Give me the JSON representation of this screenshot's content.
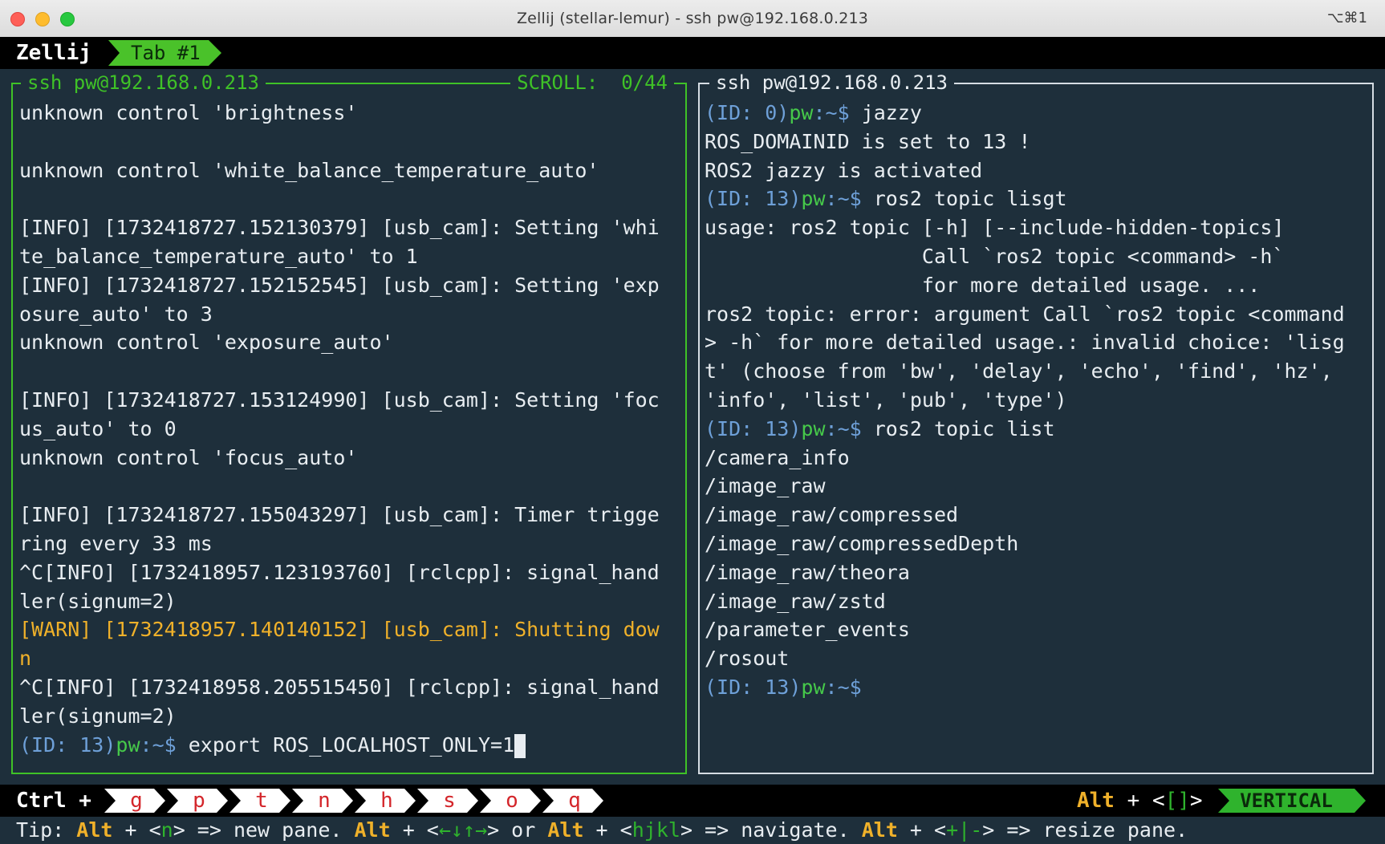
{
  "window": {
    "title": "Zellij (stellar-lemur) - ssh pw@192.168.0.213",
    "shortcut": "⌥⌘1"
  },
  "tabbar": {
    "brand": "Zellij",
    "tab": "Tab #1"
  },
  "left_pane": {
    "title": "ssh pw@192.168.0.213",
    "scroll": "SCROLL:  0/44",
    "lines": [
      "unknown control 'brightness'",
      "",
      "unknown control 'white_balance_temperature_auto'",
      "",
      "[INFO] [1732418727.152130379] [usb_cam]: Setting 'whi",
      "te_balance_temperature_auto' to 1",
      "[INFO] [1732418727.152152545] [usb_cam]: Setting 'exp",
      "osure_auto' to 3",
      "unknown control 'exposure_auto'",
      "",
      "[INFO] [1732418727.153124990] [usb_cam]: Setting 'foc",
      "us_auto' to 0",
      "unknown control 'focus_auto'",
      "",
      "[INFO] [1732418727.155043297] [usb_cam]: Timer trigge",
      "ring every 33 ms",
      "^C[INFO] [1732418957.123193760] [rclcpp]: signal_hand",
      "ler(signum=2)",
      "[WARN] [1732418957.140140152] [usb_cam]: Shutting dow",
      "n",
      "^C[INFO] [1732418958.205515450] [rclcpp]: signal_hand",
      "ler(signum=2)"
    ],
    "prompt": {
      "id": "(ID: 13)",
      "user": "pw",
      "path": ":~$ ",
      "command": "export ROS_LOCALHOST_ONLY=1"
    }
  },
  "right_pane": {
    "title": "ssh pw@192.168.0.213",
    "prompt1": {
      "id": "(ID: 0)",
      "user": "pw",
      "path": ":~$ ",
      "command": "jazzy"
    },
    "block1": [
      "ROS_DOMAINID is set to 13 !",
      "ROS2 jazzy is activated"
    ],
    "prompt2": {
      "id": "(ID: 13)",
      "user": "pw",
      "path": ":~$ ",
      "command": "ros2 topic lisgt"
    },
    "block2": [
      "usage: ros2 topic [-h] [--include-hidden-topics]",
      "                  Call `ros2 topic <command> -h`",
      "                  for more detailed usage. ...",
      "ros2 topic: error: argument Call `ros2 topic <command",
      "> -h` for more detailed usage.: invalid choice: 'lisg",
      "t' (choose from 'bw', 'delay', 'echo', 'find', 'hz',",
      "'info', 'list', 'pub', 'type')"
    ],
    "prompt3": {
      "id": "(ID: 13)",
      "user": "pw",
      "path": ":~$ ",
      "command": "ros2 topic list"
    },
    "block3": [
      "/camera_info",
      "/image_raw",
      "/image_raw/compressed",
      "/image_raw/compressedDepth",
      "/image_raw/theora",
      "/image_raw/zstd",
      "/parameter_events",
      "/rosout"
    ],
    "prompt4": {
      "id": "(ID: 13)",
      "user": "pw",
      "path": ":~$",
      "command": ""
    }
  },
  "statusbar": {
    "ctrl": "Ctrl +",
    "keys": [
      "g",
      "p",
      "t",
      "n",
      "h",
      "s",
      "o",
      "q"
    ],
    "alt": "Alt",
    "plus": " + ",
    "bracket_open": "<",
    "bracket_keys": "[]",
    "bracket_close": ">",
    "mode": "VERTICAL"
  },
  "tip": {
    "prefix": "Tip: ",
    "alt": "Alt",
    "k1": "n",
    "t1": "> => new pane. ",
    "k2": "←↓↑→",
    "t2": "> or ",
    "k3": "hjkl",
    "t3": "> => navigate. ",
    "k4": "+|-",
    "t4": "> => resize pane."
  },
  "colors": {
    "background": "#1e2f3b",
    "active_border": "#3fc227",
    "warn": "#f0b12a",
    "prompt_id": "#6ea0d8",
    "prompt_user": "#46c94a"
  }
}
